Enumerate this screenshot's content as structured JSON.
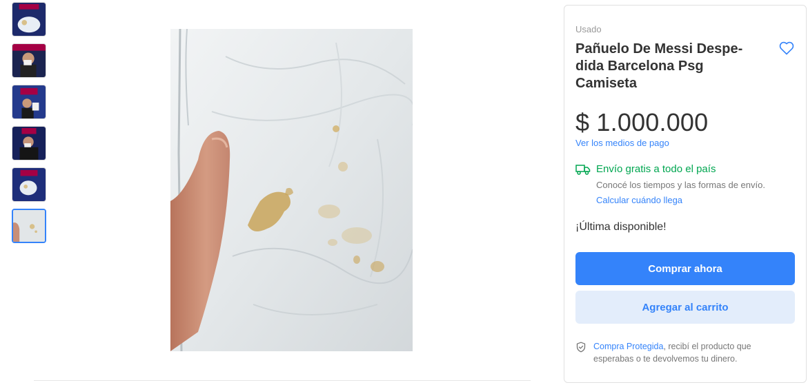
{
  "gallery": {
    "thumbnails": [
      {
        "name": "thumbnail-1",
        "selected": false
      },
      {
        "name": "thumbnail-2",
        "selected": false
      },
      {
        "name": "thumbnail-3",
        "selected": false
      },
      {
        "name": "thumbnail-4",
        "selected": false
      },
      {
        "name": "thumbnail-5",
        "selected": false
      },
      {
        "name": "thumbnail-6",
        "selected": true
      }
    ]
  },
  "product": {
    "condition": "Usado",
    "title": "Pañuelo De Messi Despe-dida Barcelona Psg Camiseta",
    "price": "$ 1.000.000",
    "payment_link": "Ver los medios de pago"
  },
  "shipping": {
    "title": "Envío gratis a todo el país",
    "description": "Conocé los tiempos y las formas de envío.",
    "link": "Calcular cuándo llega"
  },
  "stock": {
    "label": "¡Última disponible!"
  },
  "actions": {
    "buy_label": "Comprar ahora",
    "cart_label": "Agregar al carrito"
  },
  "protection": {
    "link": "Compra Protegida",
    "text": ", recibí el producto que esperabas o te devolvemos tu dinero."
  },
  "colors": {
    "accent": "#3483fa",
    "accent_light": "#e3edfb",
    "shipping_green": "#00a650"
  },
  "icons": {
    "favorite": "heart-icon",
    "shipping": "truck-icon",
    "protection": "shield-check-icon"
  }
}
